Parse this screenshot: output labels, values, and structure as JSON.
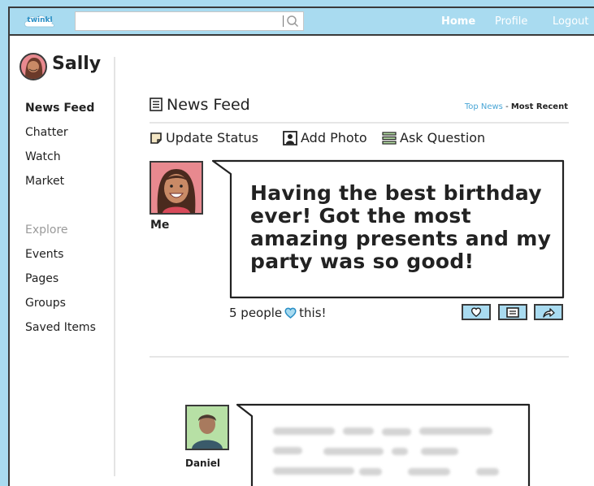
{
  "topbar": {
    "logo_text": "twinkl",
    "search_value": "",
    "nav": [
      "Home",
      "Profile",
      "Logout"
    ]
  },
  "user": {
    "name": "Sally"
  },
  "sidebar": {
    "items": [
      {
        "label": "News Feed"
      },
      {
        "label": "Chatter"
      },
      {
        "label": "Watch"
      },
      {
        "label": "Market"
      }
    ],
    "explore_heading": "Explore",
    "explore_items": [
      {
        "label": "Events"
      },
      {
        "label": "Pages"
      },
      {
        "label": "Groups"
      },
      {
        "label": "Saved Items"
      }
    ]
  },
  "feed": {
    "title": "News Feed",
    "sort_top": "Top News",
    "sort_sep": " - ",
    "sort_recent": "Most Recent",
    "actions": [
      {
        "label": "Update Status",
        "icon": "note-icon"
      },
      {
        "label": "Add Photo",
        "icon": "photo-icon"
      },
      {
        "label": "Ask Question",
        "icon": "list-icon"
      }
    ]
  },
  "posts": [
    {
      "author": "Me",
      "text": "Having the best birthday ever! Got the most amazing presents and my party was so good!",
      "likes_prefix": "5 people",
      "likes_suffix": "this!"
    },
    {
      "author": "Daniel"
    }
  ],
  "colors": {
    "accent": "#a9dbf0",
    "link": "#4aa6d6",
    "heart": "#2a8fc6"
  }
}
